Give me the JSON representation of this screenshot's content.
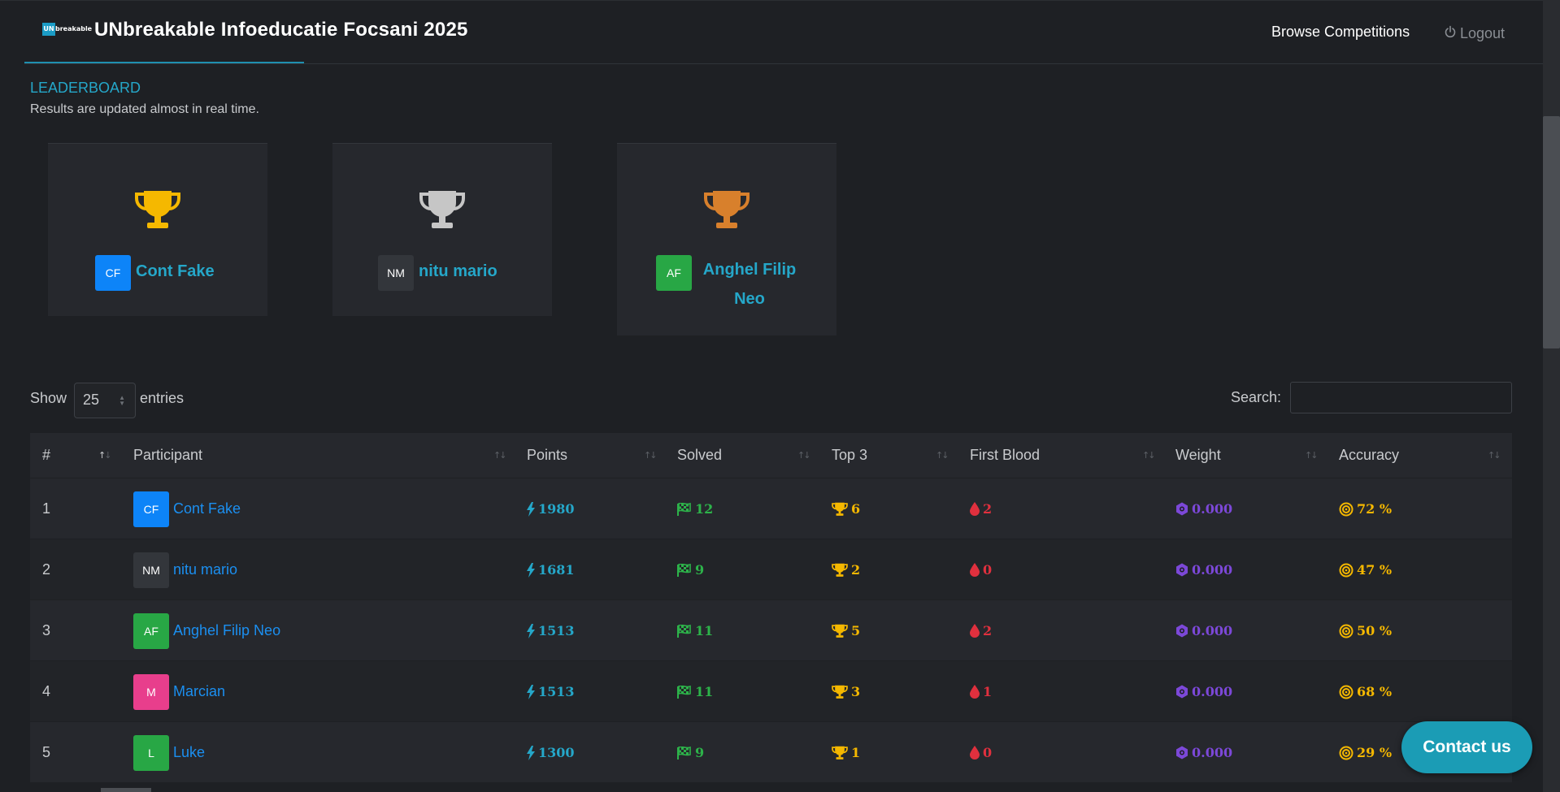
{
  "header": {
    "logo_un": "UN",
    "logo_rest": "breakable",
    "title": "UNbreakable Infoeducatie Focsani 2025",
    "browse_label": "Browse Competitions",
    "logout_label": "Logout"
  },
  "leaderboard": {
    "title": "LEADERBOARD",
    "subtitle": "Results are updated almost in real time."
  },
  "podium": [
    {
      "initials": "CF",
      "name": "Cont Fake",
      "avatar_color": "#0d84f8",
      "trophy_color": "#f5b800"
    },
    {
      "initials": "NM",
      "name": "nitu mario",
      "avatar_color": "#33363b",
      "trophy_color": "#c6c6c6"
    },
    {
      "initials": "AF",
      "name": "Anghel Filip Neo",
      "avatar_color": "#28a745",
      "trophy_color": "#d8802c"
    }
  ],
  "controls": {
    "show_label": "Show",
    "entries_value": "25",
    "entries_label": "entries",
    "search_label": "Search:"
  },
  "table": {
    "headers": [
      "#",
      "Participant",
      "Points",
      "Solved",
      "Top 3",
      "First Blood",
      "Weight",
      "Accuracy"
    ],
    "rows": [
      {
        "rank": "1",
        "initials": "CF",
        "avatar_color": "#0d84f8",
        "name": "Cont Fake",
        "points": "1980",
        "solved": "12",
        "top3": "6",
        "first_blood": "2",
        "weight": "0.000",
        "accuracy": "72 %"
      },
      {
        "rank": "2",
        "initials": "NM",
        "avatar_color": "#33363b",
        "name": "nitu mario",
        "points": "1681",
        "solved": "9",
        "top3": "2",
        "first_blood": "0",
        "weight": "0.000",
        "accuracy": "47 %"
      },
      {
        "rank": "3",
        "initials": "AF",
        "avatar_color": "#28a745",
        "name": "Anghel Filip Neo",
        "points": "1513",
        "solved": "11",
        "top3": "5",
        "first_blood": "2",
        "weight": "0.000",
        "accuracy": "50 %"
      },
      {
        "rank": "4",
        "initials": "M",
        "avatar_color": "#e83e8c",
        "name": "Marcian",
        "points": "1513",
        "solved": "11",
        "top3": "3",
        "first_blood": "1",
        "weight": "0.000",
        "accuracy": "68 %"
      },
      {
        "rank": "5",
        "initials": "L",
        "avatar_color": "#28a745",
        "name": "Luke",
        "points": "1300",
        "solved": "9",
        "top3": "1",
        "first_blood": "0",
        "weight": "0.000",
        "accuracy": "29 %"
      }
    ]
  },
  "contact": {
    "label": "Contact us"
  }
}
